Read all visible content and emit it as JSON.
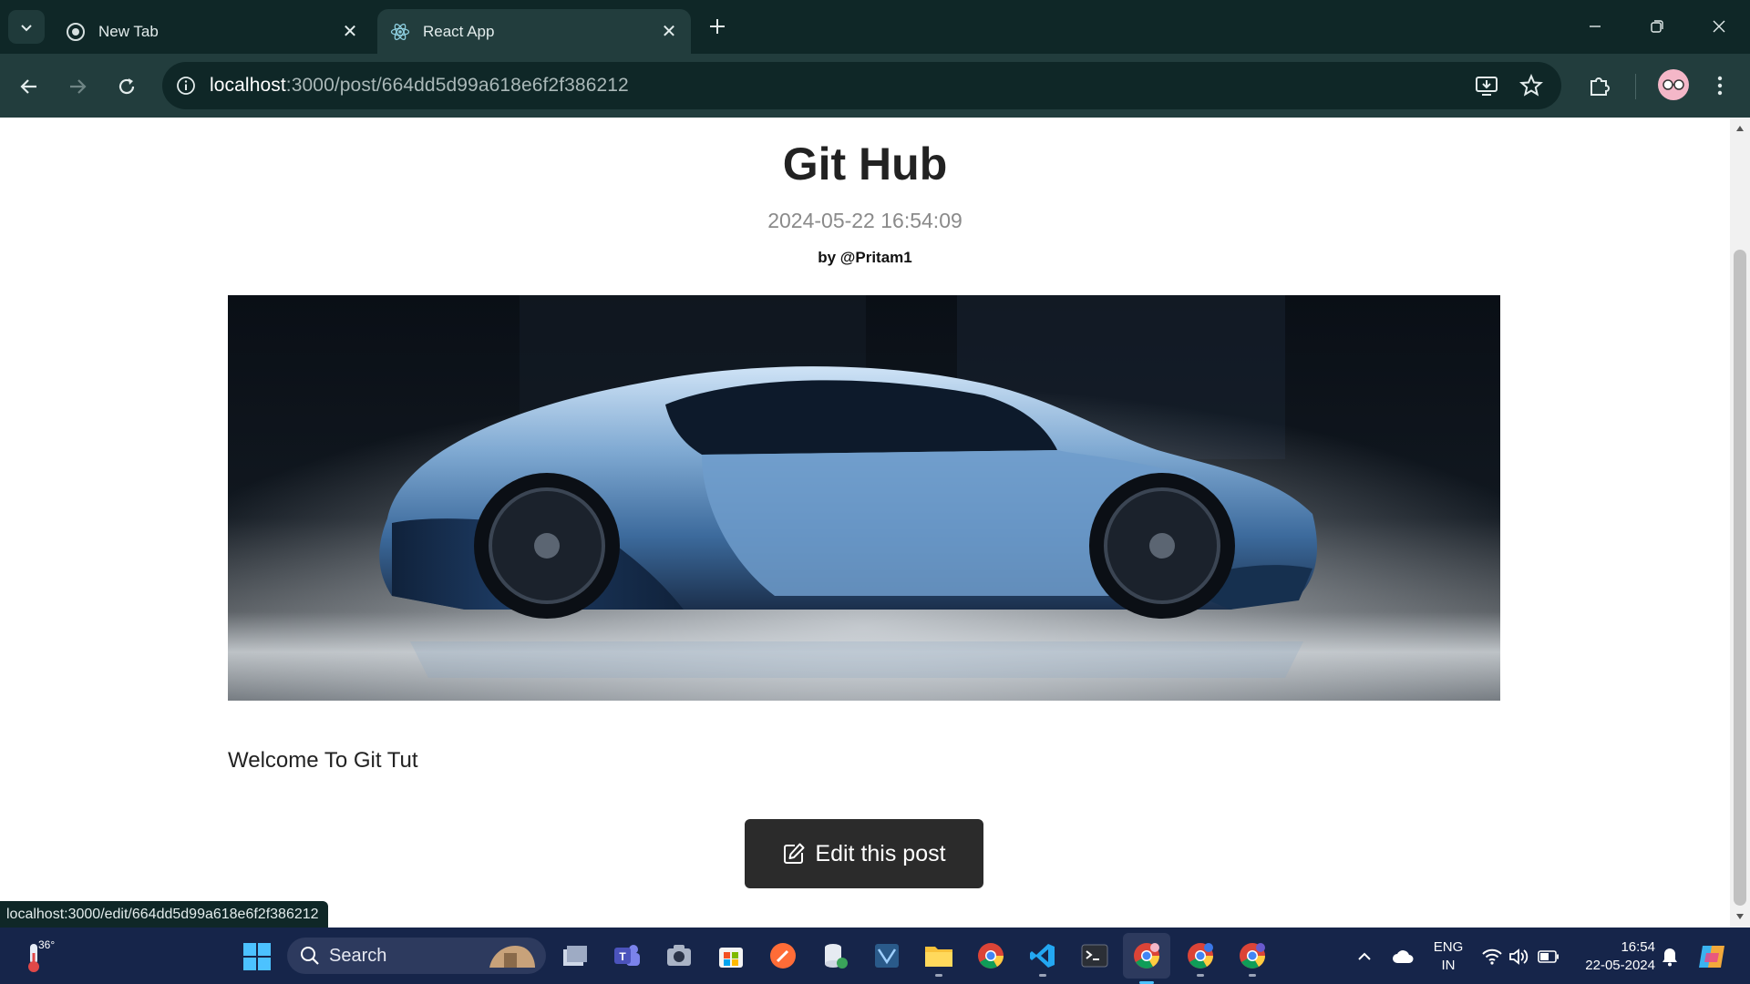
{
  "browser": {
    "tabs": [
      {
        "title": "New Tab",
        "icon": "chrome-icon",
        "active": false
      },
      {
        "title": "React App",
        "icon": "react-icon",
        "active": true
      }
    ],
    "address": {
      "host": "localhost",
      "path": ":3000/post/664dd5d99a618e6f2f386212"
    },
    "accent": "#223d3d"
  },
  "post": {
    "title": "Git Hub",
    "time": "2024-05-22 16:54:09",
    "author": "by @Pritam1",
    "content": "Welcome To Git Tut",
    "edit_label": "Edit this post",
    "image_alt": "blue sports car"
  },
  "status_bar": {
    "link": "localhost:3000/edit/664dd5d99a618e6f2f386212"
  },
  "taskbar": {
    "weather_temp": "36°",
    "search_label": "Search",
    "language_top": "ENG",
    "language_bottom": "IN",
    "clock_time": "16:54",
    "clock_date": "22-05-2024"
  }
}
